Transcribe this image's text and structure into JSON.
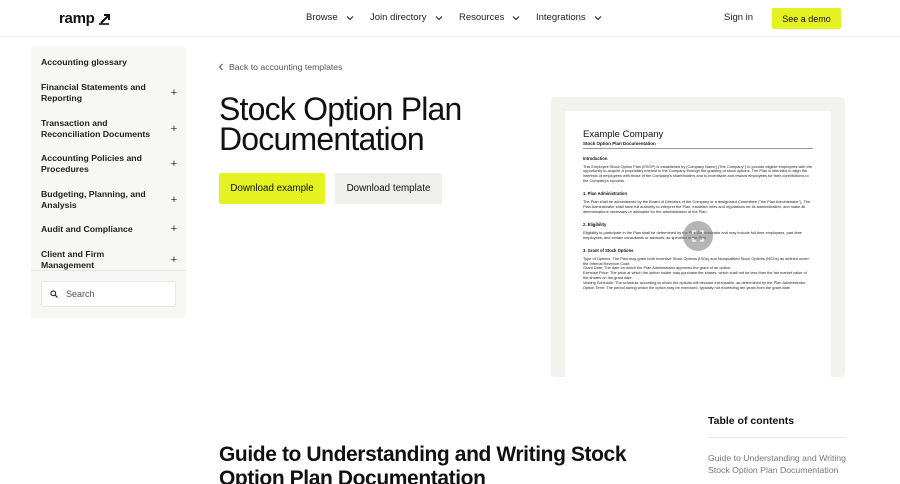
{
  "header": {
    "logo_text": "ramp",
    "nav": [
      {
        "label": "Browse"
      },
      {
        "label": "Join directory"
      },
      {
        "label": "Resources"
      },
      {
        "label": "Integrations"
      }
    ],
    "sign_in": "Sign in",
    "demo_button": "See a demo"
  },
  "sidebar": {
    "items": [
      {
        "label": "Accounting glossary",
        "expandable": false
      },
      {
        "label": "Financial Statements and Reporting",
        "expandable": true
      },
      {
        "label": "Transaction and Reconciliation Documents",
        "expandable": true
      },
      {
        "label": "Accounting Policies and Procedures",
        "expandable": true
      },
      {
        "label": "Budgeting, Planning, and Analysis",
        "expandable": true
      },
      {
        "label": "Audit and Compliance",
        "expandable": true
      },
      {
        "label": "Client and Firm Management",
        "expandable": true
      }
    ],
    "plus_symbol": "+",
    "search_placeholder": "Search"
  },
  "main": {
    "back_link": "Back to accounting templates",
    "title": "Stock Option Plan Documentation",
    "download_example": "Download example",
    "download_template": "Download template"
  },
  "preview": {
    "company": "Example Company",
    "doc_title": "Stock Option Plan Documentation",
    "sections": [
      {
        "heading": "Introduction",
        "text": "This Employee Stock Option Plan (ESOP) is established by [Company Name] (\"the Company\") to provide eligible employees with the opportunity to acquire a proprietary interest in the Company through the granting of stock options. The Plan is intended to align the interests of employees with those of the Company's shareholders and to incentivize and reward employees for their contributions to the Company's success."
      },
      {
        "heading": "1. Plan Administration",
        "text": "The Plan shall be administered by the Board of Directors of the Company or a designated Committee (\"the Plan Administrator\"). The Plan Administrator shall have full authority to interpret the Plan, establish rules and regulations for its administration, and make all determinations necessary or advisable for the administration of the Plan."
      },
      {
        "heading": "2. Eligibility",
        "text": "Eligibility to participate in the Plan shall be determined by the Plan Administrator and may include full-time employees, part-time employees, and certain consultants or advisors, as specified in the Plan."
      }
    ],
    "grant_heading": "3. Grant of Stock Options",
    "grant_items": [
      "Type of Options: The Plan may grant both Incentive Stock Options (ISOs) and Nonqualified Stock Options (NSOs) as defined under the Internal Revenue Code.",
      "Grant Date: The date on which the Plan Administrator approves the grant of an option.",
      "Exercise Price: The price at which the option holder may purchase the shares, which shall not be less than the fair market value of the shares on the grant date.",
      "Vesting Schedule: The schedule according to which the options will become exercisable, as determined by the Plan Administrator.",
      "Option Term: The period during which the option may be exercised, typically not exceeding ten years from the grant date."
    ]
  },
  "lower": {
    "section_title": "Guide to Understanding and Writing Stock Option Plan Documentation",
    "toc_heading": "Table of contents",
    "toc_items": [
      "Guide to Understanding and Writing Stock Option Plan Documentation"
    ]
  },
  "colors": {
    "accent": "#e4f222",
    "sidebar_bg": "#f7f7f5",
    "secondary_btn": "#efefec"
  },
  "icons": [
    "logo-mark-icon",
    "chevron-down-icon",
    "chevron-left-icon",
    "search-icon",
    "expand-icon",
    "plus-icon"
  ]
}
